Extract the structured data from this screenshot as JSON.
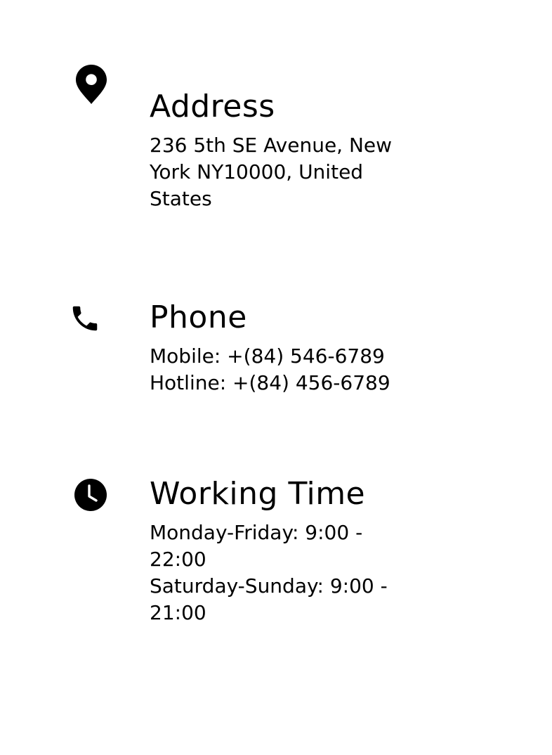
{
  "address": {
    "icon": "map-pin-icon",
    "title": "Address",
    "lines": [
      "236 5th SE Avenue, New",
      "York NY10000, United",
      "States"
    ]
  },
  "phone": {
    "icon": "phone-icon",
    "title": "Phone",
    "lines": [
      "Mobile: +(84) 546-6789",
      "Hotline: +(84) 456-6789"
    ]
  },
  "working_time": {
    "icon": "clock-icon",
    "title": "Working Time",
    "lines": [
      "Monday-Friday: 9:00 -",
      "22:00",
      "Saturday-Sunday: 9:00 -",
      "21:00"
    ]
  },
  "colors": {
    "text": "#000000",
    "background": "#ffffff"
  }
}
